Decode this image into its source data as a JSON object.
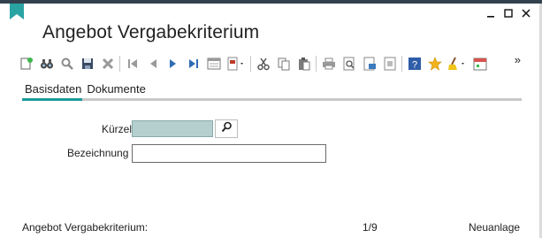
{
  "window": {
    "title": "Angebot Vergabekriterium",
    "minimize_label": "—",
    "maximize_label": "□",
    "close_label": "✕"
  },
  "toolbar": {
    "icons": [
      "new-record-icon",
      "binoculars-icon",
      "search-icon",
      "save-icon",
      "delete-icon",
      "first-record-icon",
      "previous-record-icon",
      "next-record-icon",
      "last-record-icon",
      "form-view-icon",
      "report-dropdown-icon",
      "cut-icon",
      "copy-icon",
      "paste-icon",
      "print-icon",
      "print-preview-icon",
      "export-icon",
      "page-setup-icon",
      "help-icon",
      "favorite-icon",
      "clear-dropdown-icon",
      "calendar-icon"
    ],
    "overflow_label": "»"
  },
  "tabs": [
    {
      "label": "Basisdaten",
      "active": true
    },
    {
      "label": "Dokumente",
      "active": false
    }
  ],
  "form": {
    "kuerzel_label": "Kürzel",
    "kuerzel_value": "",
    "bezeichnung_label": "Bezeichnung",
    "bezeichnung_value": ""
  },
  "status": {
    "left": "Angebot Vergabekriterium:",
    "record_position": "1/9",
    "mode": "Neuanlage"
  },
  "colors": {
    "accent": "#1e9b9b",
    "topbar": "#33414e",
    "required_field": "#b5cfcf"
  }
}
